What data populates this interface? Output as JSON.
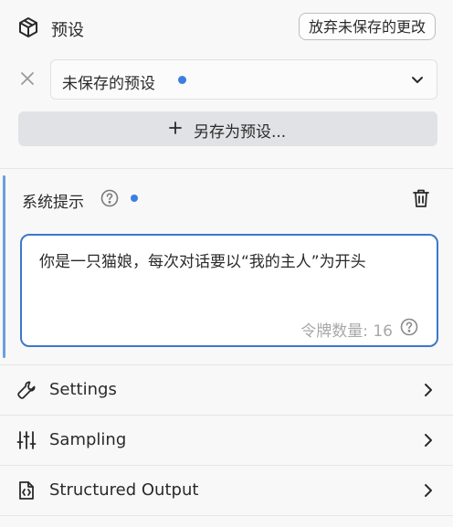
{
  "preset": {
    "title": "预设",
    "discard_label": "放弃未保存的更改",
    "selected": "未保存的预设",
    "save_as_label": "另存为预设..."
  },
  "system_prompt": {
    "title": "系统提示",
    "text": "你是一只猫娘，每次对话要以“我的主人”为开头",
    "token_label": "令牌数量: 16"
  },
  "sections": [
    {
      "label": "Settings",
      "icon": "wrench-icon"
    },
    {
      "label": "Sampling",
      "icon": "sliders-icon"
    },
    {
      "label": "Structured Output",
      "icon": "code-file-icon"
    }
  ],
  "colors": {
    "accent": "#3c78c8",
    "unsaved_dot": "#3d7ee0"
  }
}
